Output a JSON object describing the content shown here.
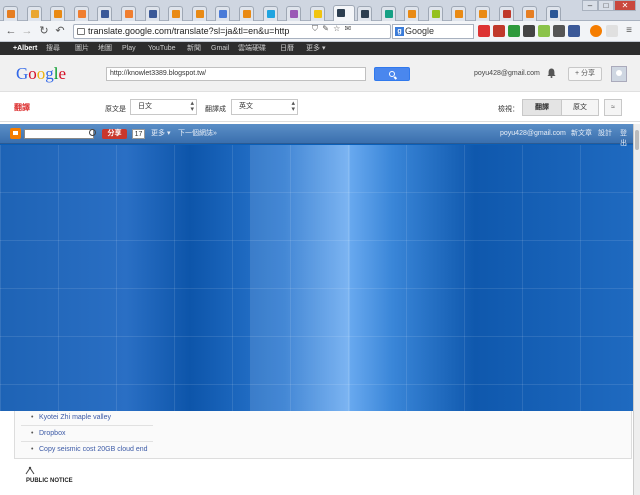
{
  "browser": {
    "tabs": [
      {
        "color": "#e67e22"
      },
      {
        "color": "#e9a630"
      },
      {
        "color": "#e98a14"
      },
      {
        "color": "#f07e2f"
      },
      {
        "color": "#3b5998"
      },
      {
        "color": "#f07e2f"
      },
      {
        "color": "#3b5998"
      },
      {
        "color": "#e98a14"
      },
      {
        "color": "#e98a14"
      },
      {
        "color": "#4a7bd8"
      },
      {
        "color": "#e98a14"
      },
      {
        "color": "#1fa4e0"
      },
      {
        "color": "#9b59b6"
      },
      {
        "color": "#f1c40f"
      },
      {
        "color": "#2c3e50"
      },
      {
        "color": "#2c3e50"
      },
      {
        "color": "#16a085"
      },
      {
        "color": "#e98a14"
      },
      {
        "color": "#95c11f"
      },
      {
        "color": "#e98a14"
      },
      {
        "color": "#e98a14"
      },
      {
        "color": "#c0392b"
      },
      {
        "color": "#e67e22"
      },
      {
        "color": "#2b5797"
      }
    ],
    "url": "translate.google.com/translate?sl=ja&tl=en&u=http",
    "search_placeholder": "Google"
  },
  "gbar": {
    "items": [
      "+Albert",
      "搜尋",
      "圖片",
      "地圖",
      "Play",
      "YouTube",
      "新聞",
      "Gmail",
      "雲端硬碟",
      "日曆",
      "更多 ▾"
    ]
  },
  "header": {
    "logo": "Google",
    "url_value": "http://knowlet3389.blogspot.tw/",
    "user_email": "poyu428@gmail.com",
    "share_label": "+ 分享"
  },
  "translate": {
    "logo_text": "翻譯",
    "from_label": "原文是",
    "from_value": "日文",
    "to_label": "翻譯成",
    "to_value": "英文",
    "view_label": "檢視：",
    "view_translated": "翻譯",
    "view_original": "原文",
    "collapse_symbol": "≈"
  },
  "blogger": {
    "share": "分享",
    "count": "17",
    "more": "更多 ▾",
    "next_blog": "下一個網誌»",
    "email": "poyu428@gmail.com",
    "new_post": "新文章",
    "design": "設計",
    "sign_out": "登出"
  },
  "links": [
    "Kyotei Zhi maple valley",
    "Dropbox",
    "Copy seismic cost 20GB cloud end"
  ],
  "notice": "PUBLIC NOTICE"
}
